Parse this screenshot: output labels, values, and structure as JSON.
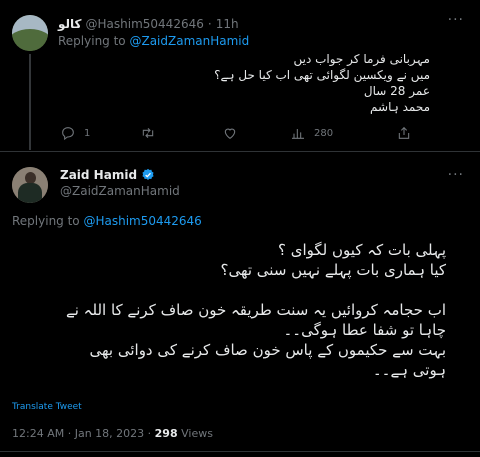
{
  "reply_tweet": {
    "author_name": "كالو",
    "handle": "@Hashim50442646",
    "separator": "·",
    "time": "11h",
    "replying_prefix": "Replying to",
    "replying_to": "@ZaidZamanHamid",
    "text_lines": [
      "مہربانی فرما کر جواب دیں",
      "میں نے ویکسین لگوائی تھی اب کیا حل ہے؟",
      "عمر 28 سال",
      "محمد ہاشم"
    ],
    "reply_count": "1",
    "retweet_count": "",
    "like_count": "",
    "view_count": "280"
  },
  "main_tweet": {
    "author_name": "Zaid Hamid",
    "handle": "@ZaidZamanHamid",
    "replying_prefix": "Replying to",
    "replying_to": "@Hashim50442646",
    "text_lines": [
      "پہلی بات کہ کیوں لگوای ؟",
      "کیا ہماری بات پہلے نہیں سنی تھی؟",
      "",
      "اب حجامہ کروائیں یہ سنت طریقہ خون صاف کرنے کا اللہ نے",
      "چاہا تو شفا عطا ہوگی۔۔",
      "بہت سے حکیموں کے پاس خون صاف کرنے کی دوائی بھی",
      "ہوتی ہے۔۔"
    ],
    "translate_label": "Translate Tweet",
    "time": "12:24 AM",
    "date": "Jan 18, 2023",
    "views_count": "298",
    "views_label": "Views",
    "separator": "·"
  },
  "colors": {
    "background": "#000000",
    "text": "#e7e9ea",
    "secondary": "#71767b",
    "link": "#1d9bf0",
    "divider": "#2f3336"
  }
}
